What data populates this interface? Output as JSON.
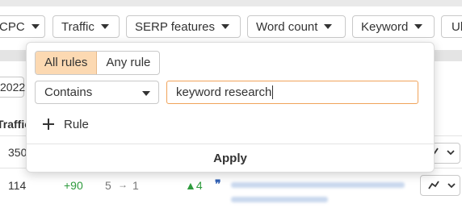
{
  "filters": [
    {
      "label": "CPC"
    },
    {
      "label": "Traffic"
    },
    {
      "label": "SERP features"
    },
    {
      "label": "Word count"
    },
    {
      "label": "Keyword"
    },
    {
      "label": "Ul"
    }
  ],
  "background": {
    "date_partial": "2022",
    "column_header_partial": "Traffic",
    "row1": {
      "traffic": "350"
    },
    "row2": {
      "traffic": "114",
      "change": "+90",
      "position_from": "5",
      "position_arrow": "→",
      "position_to": "1",
      "pos_change": "▲4",
      "quote_icon": "❞"
    }
  },
  "panel": {
    "mode_tabs": [
      {
        "label": "All rules",
        "active": true
      },
      {
        "label": "Any rule",
        "active": false
      }
    ],
    "condition": "Contains",
    "value": "keyword research",
    "add_rule_label": "Rule",
    "apply_label": "Apply"
  }
}
